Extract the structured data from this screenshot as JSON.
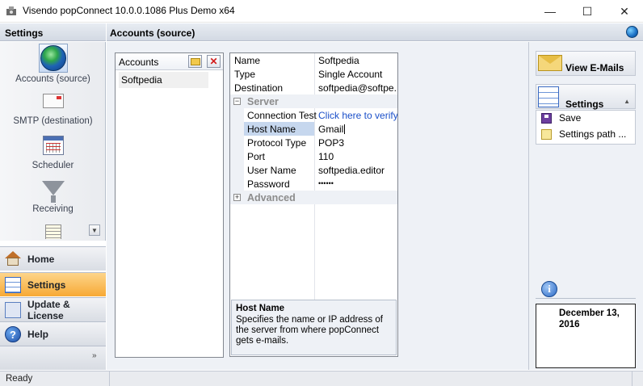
{
  "window": {
    "title": "Visendo popConnect 10.0.0.1086 Plus Demo x64",
    "minimize": "—",
    "maximize": "☐",
    "close": "✕"
  },
  "sidebar": {
    "header": "Settings",
    "nav": [
      {
        "label": "Accounts (source)",
        "icon": "globe-icon",
        "selected": true
      },
      {
        "label": "SMTP (destination)",
        "icon": "envelope-icon"
      },
      {
        "label": "Scheduler",
        "icon": "calendar-icon"
      },
      {
        "label": "Receiving",
        "icon": "filter-icon"
      }
    ],
    "sections": [
      {
        "label": "Home",
        "icon": "home-icon"
      },
      {
        "label": "Settings",
        "icon": "checklist-icon",
        "active": true
      },
      {
        "label": "Update & License",
        "icon": "update-icon"
      },
      {
        "label": "Help",
        "icon": "help-icon"
      }
    ],
    "footer_chevron": "»"
  },
  "main": {
    "header": "Accounts (source)",
    "accounts": {
      "header": "Accounts",
      "items": [
        "Softpedia"
      ]
    },
    "properties": {
      "rows": [
        {
          "key": "Name",
          "value": "Softpedia"
        },
        {
          "key": "Type",
          "value": "Single Account"
        },
        {
          "key": "Destination",
          "value": "softpedia@softpe..."
        }
      ],
      "server_category": "Server",
      "server_rows": [
        {
          "key": "Connection Test",
          "value": "Click here to verify"
        },
        {
          "key": "Host Name",
          "value": "Gmail"
        },
        {
          "key": "Protocol Type",
          "value": "POP3"
        },
        {
          "key": "Port",
          "value": "110"
        },
        {
          "key": "User Name",
          "value": "softpedia.editor"
        },
        {
          "key": "Password",
          "value": "••••••"
        }
      ],
      "advanced_category": "Advanced"
    },
    "description": {
      "title": "Host Name",
      "text": "Specifies the name or IP address of the server from where popConnect gets e-mails."
    }
  },
  "right": {
    "view_emails": "View E-Mails",
    "settings": "Settings",
    "actions": [
      "Save",
      "Settings path ..."
    ],
    "date": "December 13, 2016",
    "info_glyph": "i"
  },
  "status": {
    "text": "Ready"
  },
  "colors": {
    "active_section": "#f7a935",
    "header_bg": "#d3d9e3",
    "link": "#1a4fc9"
  }
}
